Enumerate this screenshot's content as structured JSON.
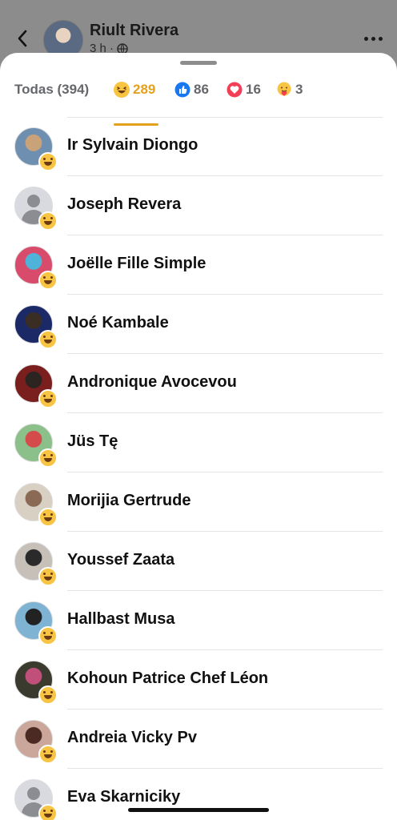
{
  "header": {
    "name": "Riult Rivera",
    "meta": "3 h ·"
  },
  "tabs": [
    {
      "label": "Todas (394)",
      "icon": "none"
    },
    {
      "label": "289",
      "icon": "haha-icon",
      "color": "#e4a11b"
    },
    {
      "label": "86",
      "icon": "like-icon",
      "color": "#1877f2"
    },
    {
      "label": "16",
      "icon": "love-icon",
      "color": "#f33e58"
    },
    {
      "label": "3",
      "icon": "care-icon",
      "color": "#f7b125"
    }
  ],
  "people": [
    {
      "name": "Ir Sylvain Diongo",
      "avatar": "photo",
      "colors": [
        "#6f8fb0",
        "#c9a27a"
      ]
    },
    {
      "name": "Joseph Revera",
      "avatar": "placeholder"
    },
    {
      "name": "Joëlle Fille Simple",
      "avatar": "photo",
      "colors": [
        "#d84b6a",
        "#4fb3d9"
      ]
    },
    {
      "name": "Noé Kambale",
      "avatar": "photo",
      "colors": [
        "#1b2a66",
        "#3a2d24"
      ]
    },
    {
      "name": "Andronique Avocevou",
      "avatar": "photo",
      "colors": [
        "#7a1e1e",
        "#2b2420"
      ]
    },
    {
      "name": "Jüs Tę",
      "avatar": "photo",
      "colors": [
        "#8cc08a",
        "#d44b4b"
      ]
    },
    {
      "name": "Morijia Gertrude",
      "avatar": "photo",
      "colors": [
        "#d9d0c4",
        "#8a6a55"
      ]
    },
    {
      "name": "Youssef Zaata",
      "avatar": "photo",
      "colors": [
        "#c6c0b8",
        "#2a2a2a"
      ]
    },
    {
      "name": "Hallbast Musa",
      "avatar": "photo",
      "colors": [
        "#7fb3d4",
        "#222"
      ]
    },
    {
      "name": "Kohoun Patrice Chef Léon",
      "avatar": "photo",
      "colors": [
        "#3a3a2e",
        "#c0507a"
      ]
    },
    {
      "name": "Andreia Vicky Pv",
      "avatar": "photo",
      "colors": [
        "#caa79a",
        "#4a2a22"
      ]
    },
    {
      "name": "Eva Skarniciky",
      "avatar": "placeholder"
    }
  ]
}
